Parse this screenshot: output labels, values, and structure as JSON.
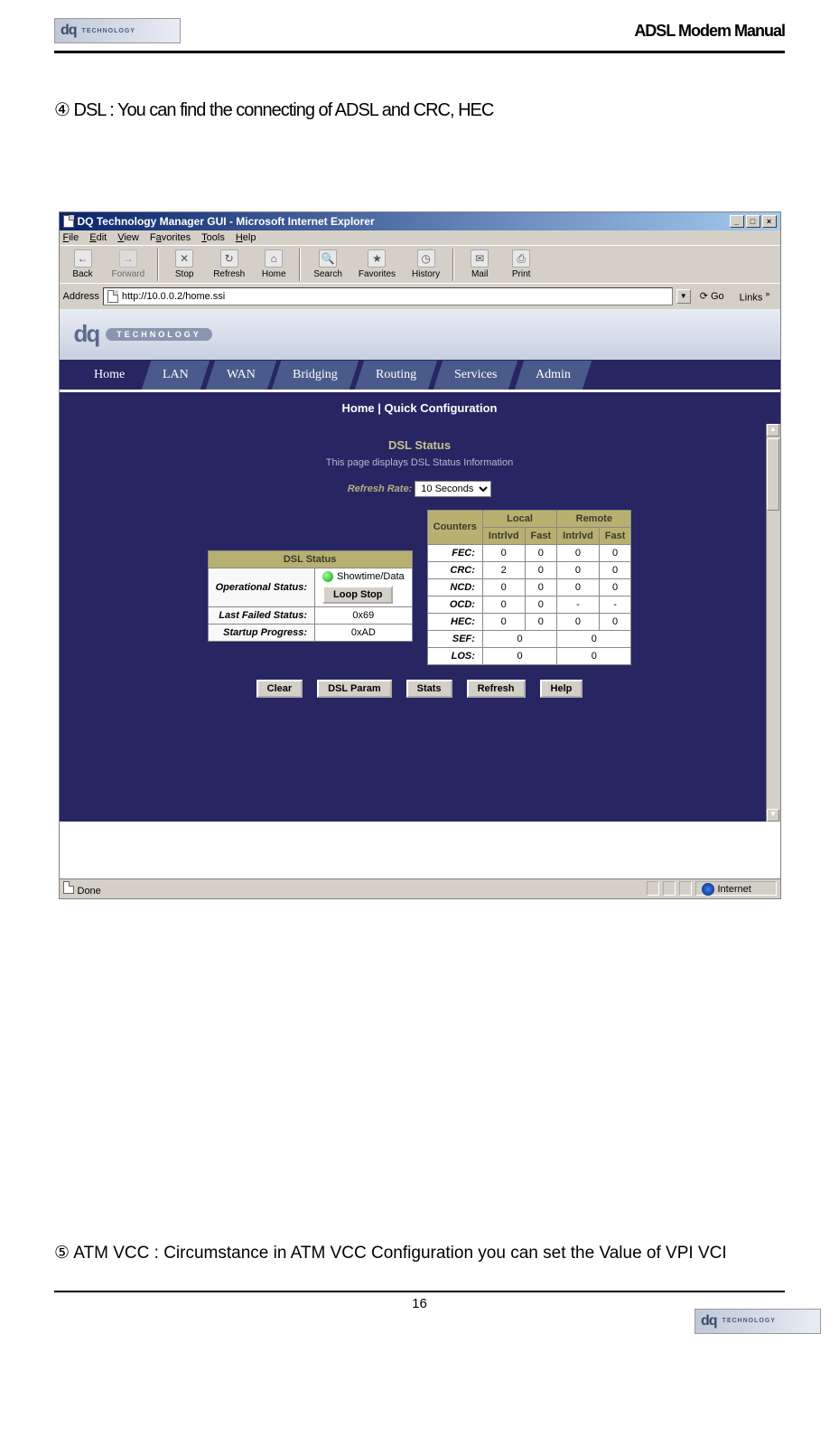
{
  "doc": {
    "header_title": "ADSL Modem Manual",
    "logo_text": "dq",
    "logo_sub": "TECHNOLOGY",
    "intro_bullet": "④",
    "intro_text": "DSL  :  You can find the connecting of ADSL and CRC, HEC",
    "atm_bullet": "⑤",
    "atm_text": "ATM VCC : Circumstance in ATM VCC Configuration you can set the Value of VPI VCI",
    "page_number": "16"
  },
  "browser": {
    "title": "DQ Technology Manager GUI - Microsoft Internet Explorer",
    "menu": [
      "File",
      "Edit",
      "View",
      "Favorites",
      "Tools",
      "Help"
    ],
    "toolbar": [
      {
        "label": "Back",
        "icon": "←"
      },
      {
        "label": "Forward",
        "icon": "→"
      },
      {
        "label": "Stop",
        "icon": "✕"
      },
      {
        "label": "Refresh",
        "icon": "↻"
      },
      {
        "label": "Home",
        "icon": "⌂"
      },
      {
        "label": "Search",
        "icon": "🔍"
      },
      {
        "label": "Favorites",
        "icon": "★"
      },
      {
        "label": "History",
        "icon": "◷"
      },
      {
        "label": "Mail",
        "icon": "✉"
      },
      {
        "label": "Print",
        "icon": "⎙"
      }
    ],
    "address_label": "Address",
    "address_value": "http://10.0.0.2/home.ssi",
    "go_label": "Go",
    "links_label": "Links",
    "status_left": "Done",
    "status_zone": "Internet"
  },
  "webui": {
    "banner_logo": "dq",
    "banner_badge": "TECHNOLOGY",
    "tabs": [
      "Home",
      "LAN",
      "WAN",
      "Bridging",
      "Routing",
      "Services",
      "Admin"
    ],
    "active_tab": "Home",
    "subnav": "Home  |  Quick Configuration",
    "section_title": "DSL Status",
    "description": "This page displays DSL Status Information",
    "refresh_label": "Refresh Rate:",
    "refresh_value": "10 Seconds",
    "status_table": {
      "header": "DSL Status",
      "rows": [
        {
          "label": "Operational Status:",
          "value": "Showtime/Data",
          "button": "Loop Stop"
        },
        {
          "label": "Last Failed Status:",
          "value": "0x69"
        },
        {
          "label": "Startup Progress:",
          "value": "0xAD"
        }
      ]
    },
    "counters_table": {
      "corner": "Counters",
      "group_headers": [
        "Local",
        "Remote"
      ],
      "sub_headers": [
        "Intrlvd",
        "Fast",
        "Intrlvd",
        "Fast"
      ],
      "rows": [
        {
          "label": "FEC:",
          "vals": [
            "0",
            "0",
            "0",
            "0"
          ]
        },
        {
          "label": "CRC:",
          "vals": [
            "2",
            "0",
            "0",
            "0"
          ]
        },
        {
          "label": "NCD:",
          "vals": [
            "0",
            "0",
            "0",
            "0"
          ]
        },
        {
          "label": "OCD:",
          "vals": [
            "0",
            "0",
            "-",
            "-"
          ]
        },
        {
          "label": "HEC:",
          "vals": [
            "0",
            "0",
            "0",
            "0"
          ]
        },
        {
          "label": "SEF:",
          "span2": [
            "0",
            "0"
          ]
        },
        {
          "label": "LOS:",
          "span2": [
            "0",
            "0"
          ]
        }
      ]
    },
    "actions": [
      "Clear",
      "DSL Param",
      "Stats",
      "Refresh",
      "Help"
    ]
  }
}
